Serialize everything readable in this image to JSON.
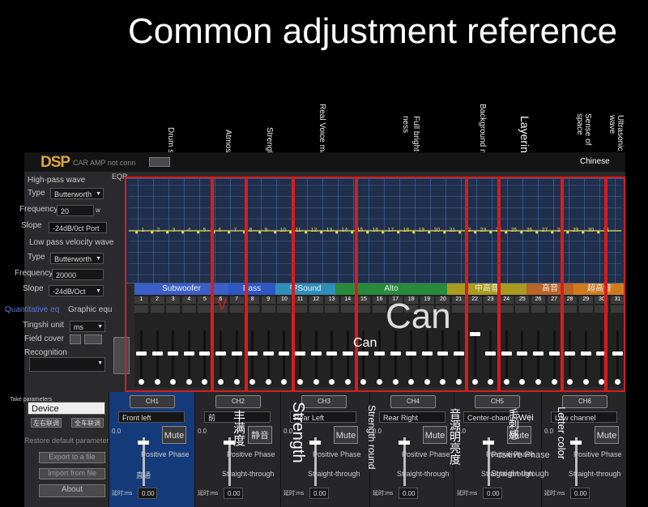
{
  "headline": "Common adjustment reference",
  "annotations": {
    "drum": "Drum s",
    "atmos": "Atmos",
    "strength_top": "Strength",
    "real_voice": "Real Voice main instrument",
    "full_brightness_1": "Full bright-",
    "full_brightness_2": "ness",
    "background": "Background music",
    "layering": "Layering",
    "sense_space_1": "Sense of",
    "sense_space_2": "space",
    "ultrasonic_1": "Ultrasonic",
    "ultrasonic_2": "wave",
    "chinese": "Chinese"
  },
  "app": {
    "logo": "DSP",
    "status": "CAR AMP not conn",
    "eqr": "EQR"
  },
  "left_panel": {
    "high_pass": "High-pass wave",
    "type_label": "Type",
    "type_value": "Butterworth",
    "freq_label": "Frequency",
    "freq_value": "20",
    "freq_unit": "w",
    "slope_label": "Slope",
    "slope_value": "-24dB/0ct Port",
    "low_pass": "Low pass velocity wave",
    "type2_label": "Type",
    "type2_value": "Butterworth",
    "freq2_label": "Frequency",
    "freq2_value": "20000",
    "slope2_label": "Slope",
    "slope2_value": "-24dB/Oct",
    "quant_eq": "Quantitative eq",
    "graphic_eq": "Graphic equ",
    "tingshi_label": "Tingshi unit",
    "tingshi_value": "ms",
    "field_cover": "Field cover",
    "recognition": "Recognition",
    "take_params": "Take parameters",
    "device": "Device",
    "btn_left_right": "左右联调",
    "btn_all": "全车联调",
    "restore": "Restore default parameters",
    "export": "Export to a file",
    "import": "Import from file",
    "about": "About"
  },
  "bands": [
    {
      "name": "Subwoofer",
      "color": "#3b5fc6"
    },
    {
      "name": "Bass",
      "color": "#2e57c4"
    },
    {
      "name": "中Sound",
      "color": "#2f8fb8"
    },
    {
      "name": "Alto",
      "color": "#2a8a3c"
    },
    {
      "name": "中高音",
      "color": "#a89b1f"
    },
    {
      "name": "高音",
      "color": "#b86428"
    },
    {
      "name": "超高音",
      "color": "#d07a1e"
    }
  ],
  "channel_numbers": [
    "1",
    "2",
    "3",
    "4",
    "5",
    "6",
    "7",
    "8",
    "9",
    "10",
    "11",
    "12",
    "13",
    "14",
    "15",
    "16",
    "17",
    "18",
    "19",
    "20",
    "21",
    "22",
    "23",
    "24",
    "25",
    "26",
    "27",
    "28",
    "29",
    "30",
    "31"
  ],
  "overlay_text": {
    "can_big": "Can",
    "can_small": "Can",
    "v_mark": "V"
  },
  "channels": [
    {
      "title": "CH1",
      "name": "Front left"
    },
    {
      "title": "CH2",
      "name": "前"
    },
    {
      "title": "CH3",
      "name": "Rear Left"
    },
    {
      "title": "CH4",
      "name": "Rear Right"
    },
    {
      "title": "CH5",
      "name": "Center-channel"
    },
    {
      "title": "CH6",
      "name": "Low channel"
    }
  ],
  "channel_controls": {
    "mute": "Mute",
    "mute_cn": "静音",
    "positive_phase": "Positive Phase",
    "straight_through": "Straight-through",
    "delay_label": "延时:ms",
    "delay_value": "0.00",
    "zhitong": "直通",
    "level_value": "0.0"
  },
  "panel_overlays": {
    "ch2_cn": "丰满度",
    "strength": "Strength",
    "strength_round": "Strength round",
    "ch4_cn": "音源明亮度",
    "ch5_cn": "毛刺感",
    "ch5_wei": "Wei",
    "letter_color": "Letter color",
    "posphase_over": "Positive Phase",
    "straight_over": "Straight-through"
  },
  "colors": {
    "accent_red": "#d61d1d",
    "graph_bg": "#1f2f4c",
    "dsp_logo": "#e2a53b",
    "ch1_panel": "#143a7a"
  }
}
